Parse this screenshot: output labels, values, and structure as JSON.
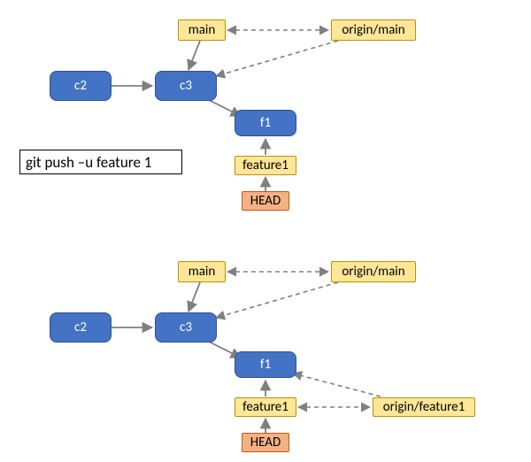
{
  "command": "git push –u feature 1",
  "colors": {
    "commitFill": "#4472C4",
    "commitStroke": "#2F528F",
    "branchFill": "#FFE699",
    "branchStroke": "#BF9000",
    "headFill": "#F4B183",
    "headStroke": "#C55A11",
    "arrowSolid": "#7F7F7F",
    "arrowDashed": "#808080"
  },
  "before": {
    "commits": {
      "c2": "c2",
      "c3": "c3",
      "f1": "f1"
    },
    "branches": {
      "main": "main",
      "origin_main": "origin/main",
      "feature1": "feature1",
      "head": "HEAD"
    },
    "edges_solid": [
      {
        "from": "c2",
        "to": "c3"
      },
      {
        "from": "c3",
        "to": "f1"
      },
      {
        "from": "main",
        "to": "c3"
      },
      {
        "from": "feature1",
        "to": "f1"
      },
      {
        "from": "HEAD",
        "to": "feature1"
      }
    ],
    "edges_dashed": [
      {
        "from": "main",
        "to": "origin/main"
      },
      {
        "from": "origin/main",
        "to": "c3"
      }
    ]
  },
  "after": {
    "commits": {
      "c2": "c2",
      "c3": "c3",
      "f1": "f1"
    },
    "branches": {
      "main": "main",
      "origin_main": "origin/main",
      "feature1": "feature1",
      "origin_feature1": "origin/feature1",
      "head": "HEAD"
    },
    "edges_solid": [
      {
        "from": "c2",
        "to": "c3"
      },
      {
        "from": "c3",
        "to": "f1"
      },
      {
        "from": "main",
        "to": "c3"
      },
      {
        "from": "feature1",
        "to": "f1"
      },
      {
        "from": "HEAD",
        "to": "feature1"
      }
    ],
    "edges_dashed": [
      {
        "from": "main",
        "to": "origin/main"
      },
      {
        "from": "origin/main",
        "to": "c3"
      },
      {
        "from": "feature1",
        "to": "origin/feature1"
      },
      {
        "from": "origin/feature1",
        "to": "f1"
      }
    ]
  }
}
